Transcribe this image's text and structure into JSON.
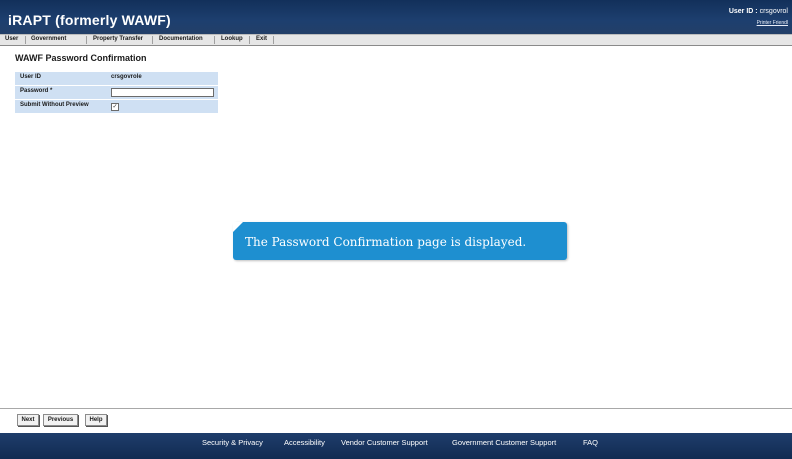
{
  "header": {
    "app_title": "iRAPT (formerly WAWF)",
    "user_id_label": "User ID :",
    "user_id_value": "crsgovrol",
    "printer_friendly": "Printer Friendl"
  },
  "menu": {
    "items": [
      "User",
      "Government",
      "Property Transfer",
      "Documentation",
      "Lookup",
      "Exit"
    ]
  },
  "page": {
    "title": "WAWF Password Confirmation"
  },
  "form": {
    "user_id_label": "User ID",
    "user_id_value": "crsgovrole",
    "password_label": "Password *",
    "password_value": "",
    "submit_label": "Submit Without Preview",
    "submit_checked": true
  },
  "callout": {
    "text": "The Password Confirmation page is displayed."
  },
  "buttons": {
    "next": "Next",
    "previous": "Previous",
    "help": "Help"
  },
  "footer": {
    "links": [
      "Security & Privacy",
      "Accessibility",
      "Vendor Customer Support",
      "Government Customer Support",
      "FAQ"
    ]
  },
  "colors": {
    "header_bg": "#1d3f6f",
    "form_row_bg": "#cfe0f3",
    "callout_bg": "#1e8fd0",
    "footer_bg": "#1a3760"
  }
}
